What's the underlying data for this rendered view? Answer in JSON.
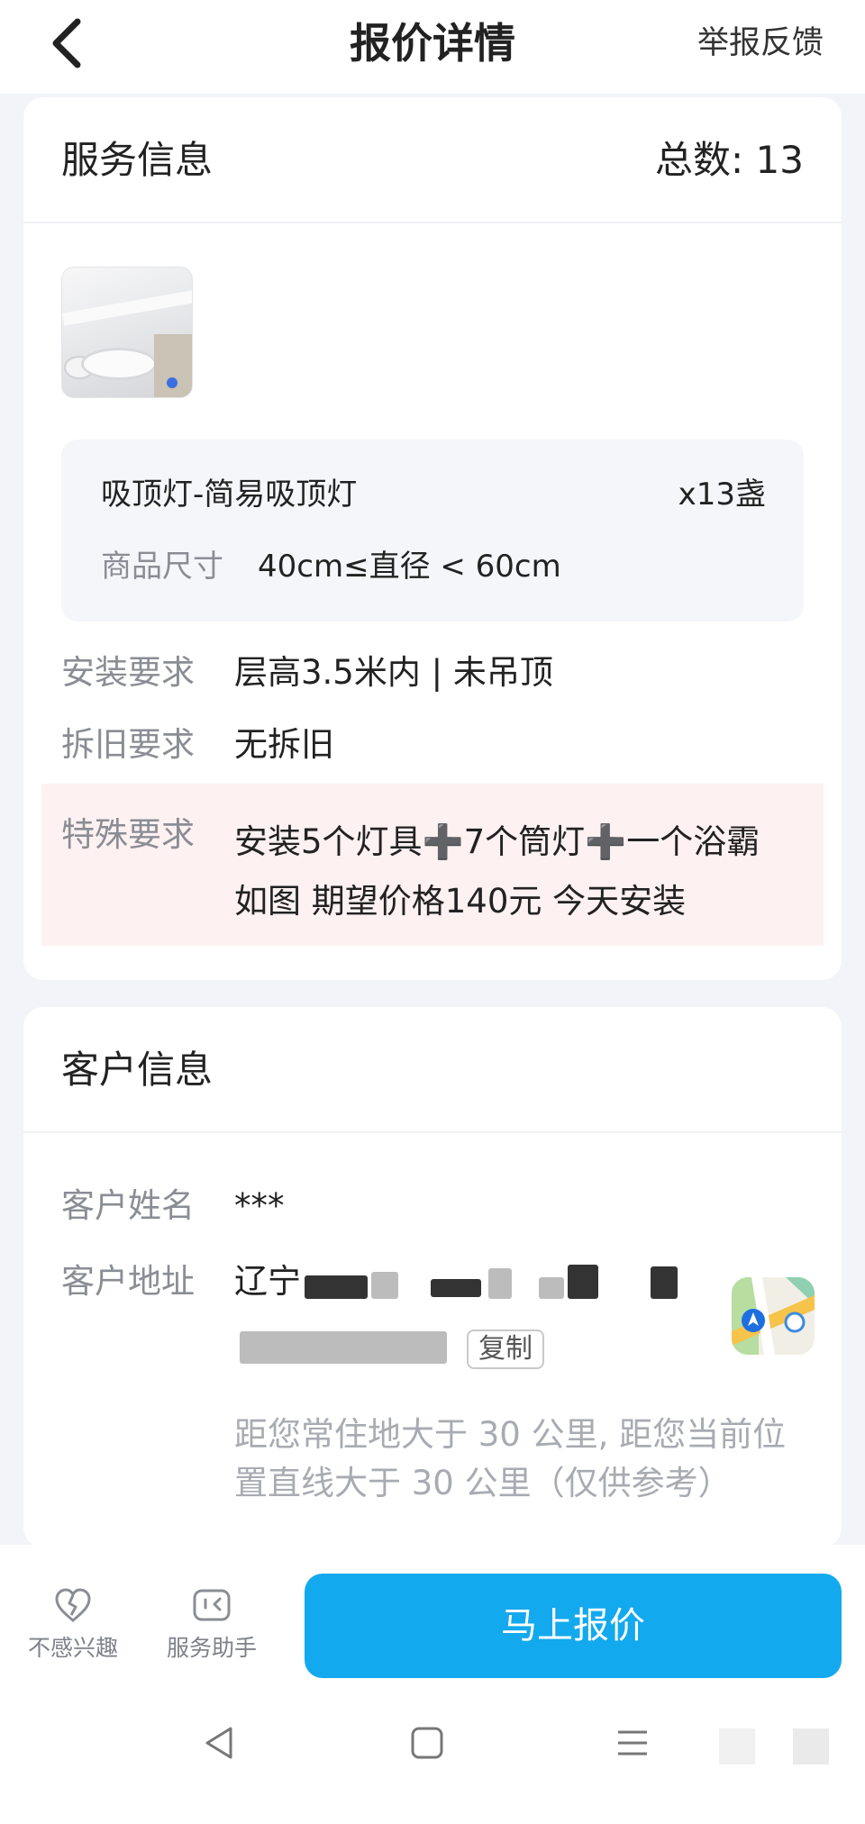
{
  "header": {
    "title": "报价详情",
    "report_label": "举报反馈"
  },
  "service": {
    "title": "服务信息",
    "count_label": "总数: 13",
    "product": {
      "name": "吸顶灯-简易吸顶灯",
      "quantity": "x13盏",
      "size_label": "商品尺寸",
      "size_value": "40cm≤直径 < 60cm"
    },
    "install_label": "安装要求",
    "install_value": "层高3.5米内 | 未吊顶",
    "remove_label": "拆旧要求",
    "remove_value": "无拆旧",
    "special_label": "特殊要求",
    "special_value": "安装5个灯具➕7个筒灯➕一个浴霸如图 期望价格140元 今天安装"
  },
  "customer": {
    "title": "客户信息",
    "name_label": "客户姓名",
    "name_value": "***",
    "address_label": "客户地址",
    "address_visible_start": "辽宁",
    "copy_label": "复制",
    "distance_note": "距您常住地大于 30 公里, 距您当前位置直线大于 30 公里（仅供参考）"
  },
  "bottom_bar": {
    "not_interested_label": "不感兴趣",
    "assistant_label": "服务助手",
    "quote_button_label": "马上报价"
  },
  "colors": {
    "accent": "#13a9ee",
    "special_bg": "#fdf1f1",
    "muted_text": "#8a8d94"
  },
  "icons": [
    "back-arrow-icon",
    "thumbnail-image",
    "map-icon",
    "broken-heart-icon",
    "chat-assistant-icon",
    "nav-back-icon",
    "nav-home-icon",
    "nav-menu-icon"
  ]
}
